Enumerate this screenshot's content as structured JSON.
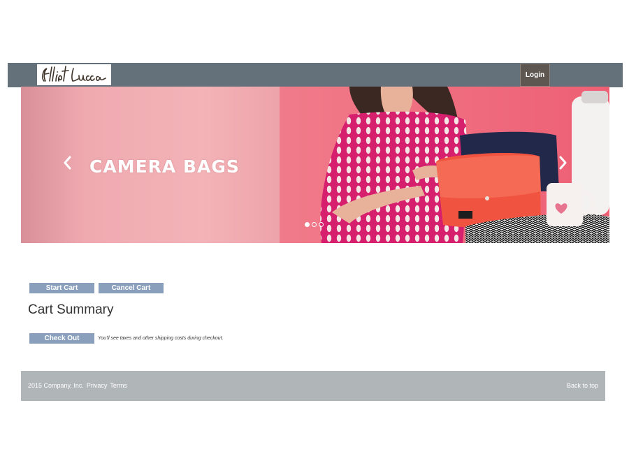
{
  "header": {
    "logo_text": "Elliott Lucca",
    "login_label": "Login"
  },
  "carousel": {
    "caption": "CAMERA BAGS",
    "prev_icon": "chevron-left-icon",
    "next_icon": "chevron-right-icon",
    "slide_count": 3,
    "active_slide": 1
  },
  "cart": {
    "start_label": "Start Cart",
    "cancel_label": "Cancel Cart",
    "summary_title": "Cart Summary",
    "checkout_label": "Check Out",
    "checkout_note": "You'll see taxes and other shipping costs during checkout."
  },
  "footer": {
    "copyright": "2015 Company, Inc.",
    "privacy_label": "Privacy",
    "terms_label": "Terms",
    "back_to_top_label": "Back to top"
  },
  "colors": {
    "navbar": "#65717a",
    "login_button": "#5e5751",
    "action_button": "#8a9fbc",
    "footer": "#b0b5b8",
    "banner_pink": "#f0a8ae"
  }
}
